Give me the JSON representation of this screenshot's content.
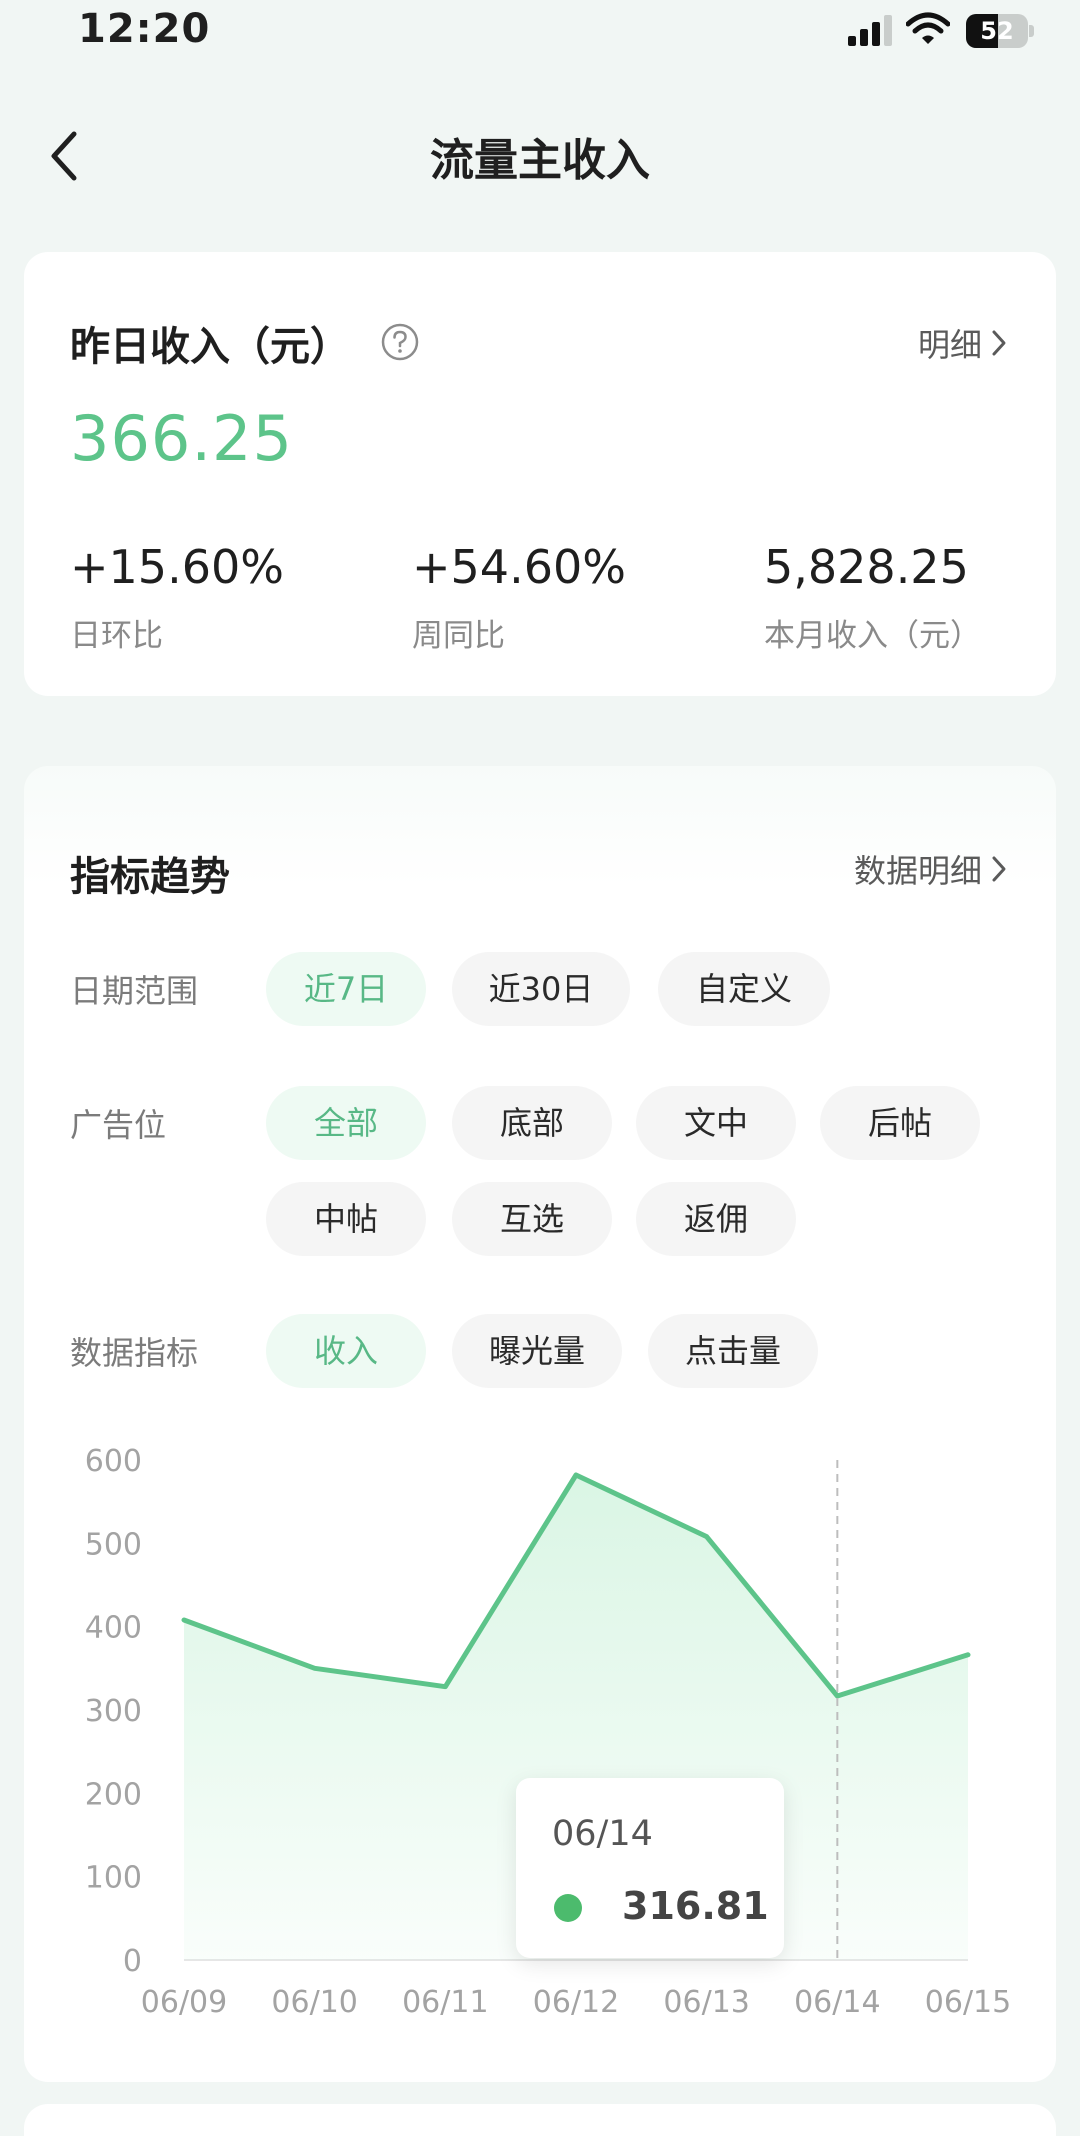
{
  "status_bar": {
    "time": "12:20",
    "battery": "52",
    "battery_level": 0.52
  },
  "nav": {
    "title": "流量主收入"
  },
  "summary": {
    "title": "昨日收入（元）",
    "detail_link": "明细",
    "yesterday_value": "366.25",
    "stats": [
      {
        "value": "+15.60%",
        "label": "日环比"
      },
      {
        "value": "+54.60%",
        "label": "周同比"
      },
      {
        "value": "5,828.25",
        "label": "本月收入（元）"
      }
    ]
  },
  "trend": {
    "title": "指标趋势",
    "detail_link": "数据明细",
    "date_range": {
      "label": "日期范围",
      "options": [
        "近7日",
        "近30日",
        "自定义"
      ],
      "selected": "近7日"
    },
    "ad_position": {
      "label": "广告位",
      "options": [
        "全部",
        "底部",
        "文中",
        "后帖",
        "中帖",
        "互选",
        "返佣"
      ],
      "selected": "全部"
    },
    "metric": {
      "label": "数据指标",
      "options": [
        "收入",
        "曝光量",
        "点击量"
      ],
      "selected": "收入"
    }
  },
  "chart_data": {
    "type": "area",
    "x": [
      "06/09",
      "06/10",
      "06/11",
      "06/12",
      "06/13",
      "06/14",
      "06/15"
    ],
    "series": [
      {
        "values": [
          408,
          350,
          328,
          582,
          508,
          316.81,
          366.25
        ]
      }
    ],
    "ylim": [
      0,
      600
    ],
    "yticks": [
      0,
      100,
      200,
      300,
      400,
      500,
      600
    ],
    "line_color": "#5dc48a",
    "fill_color": "#d8f5e3",
    "highlight_index": 5
  },
  "tooltip": {
    "date": "06/14",
    "value": "316.81"
  }
}
